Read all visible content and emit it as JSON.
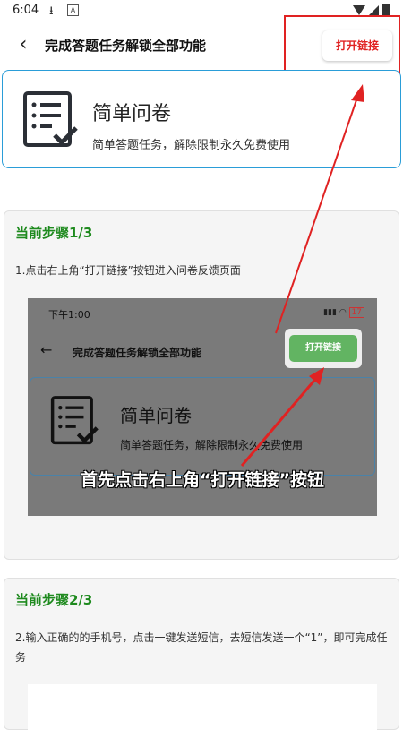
{
  "status_bar": {
    "time": "6:04"
  },
  "header": {
    "title": "完成答题任务解锁全部功能",
    "open_link_label": "打开链接"
  },
  "intro": {
    "name": "简单问卷",
    "desc": "简单答题任务，解除限制永久免费使用"
  },
  "steps": [
    {
      "title": "当前步骤1/3",
      "text": "1.点击右上角“打开链接”按钮进入问卷反馈页面",
      "screenshot": {
        "time": "下午1:00",
        "battery": "17",
        "title": "完成答题任务解锁全部功能",
        "button": "打开链接",
        "name": "简单问卷",
        "desc": "简单答题任务，解除限制永久免费使用",
        "caption": "首先点击右上角“打开链接”按钮"
      }
    },
    {
      "title": "当前步骤2/3",
      "text": "2.输入正确的的手机号，点击一键发送短信，去短信发送一个“1”，即可完成任务"
    }
  ],
  "colors": {
    "accent_red": "#e02222",
    "step_green": "#1e8a1e",
    "card_border_blue": "#2a9dd8"
  }
}
